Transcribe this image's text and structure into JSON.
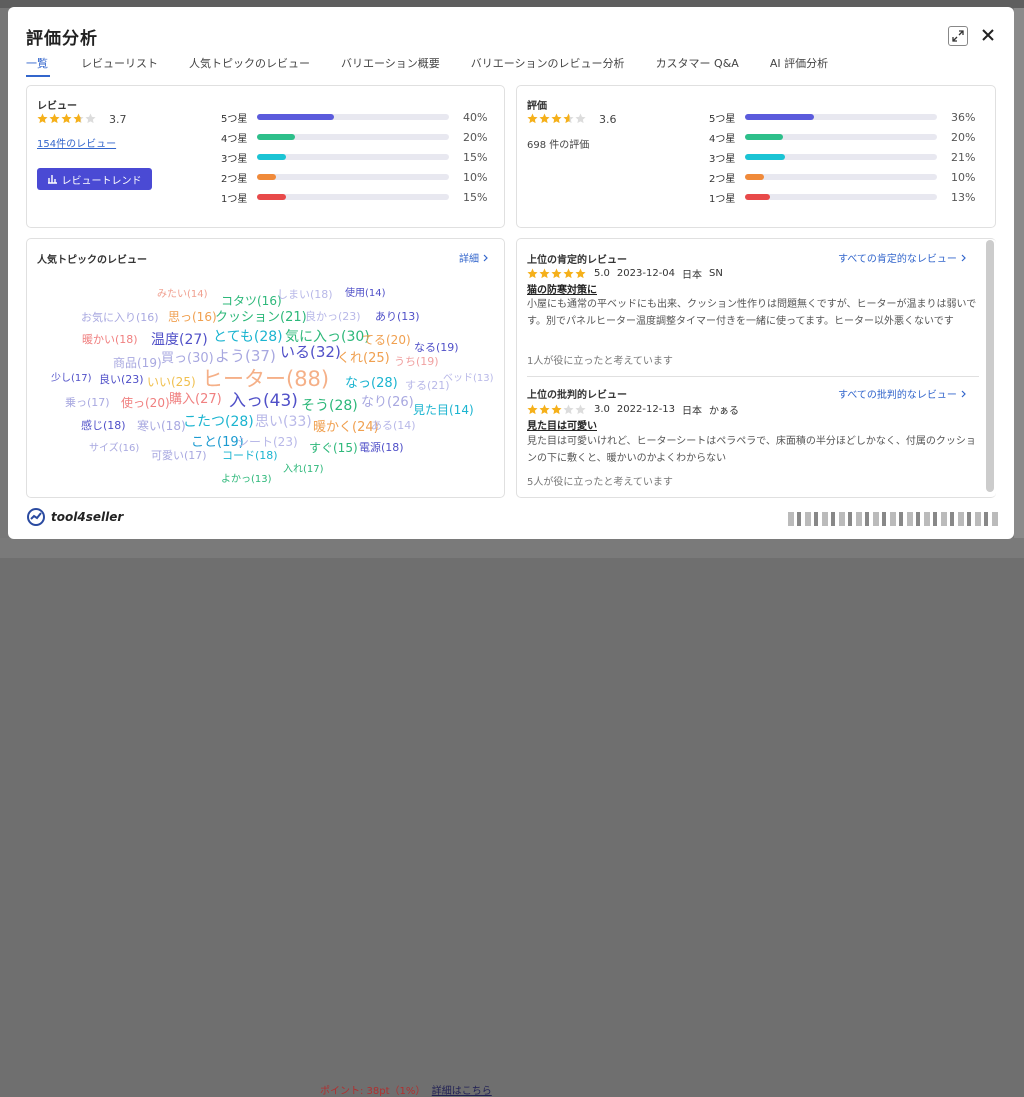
{
  "background": {
    "bottom_text": "ポイント: 38pt（1%）",
    "bottom_link": "詳細はこちら"
  },
  "modal": {
    "title": "評価分析",
    "tabs": [
      {
        "label": "一覧",
        "active": true
      },
      {
        "label": "レビューリスト"
      },
      {
        "label": "人気トピックのレビュー"
      },
      {
        "label": "バリエーション概要"
      },
      {
        "label": "バリエーションのレビュー分析"
      },
      {
        "label": "カスタマー Q&A"
      },
      {
        "label": "AI 評価分析"
      }
    ]
  },
  "reviews_card": {
    "title": "レビュー",
    "rating": "3.7",
    "rating_value": 3.7,
    "count_link": "154件のレビュー",
    "trend_button": "レビュートレンド",
    "distribution": [
      {
        "label": "5つ星",
        "pct": "40%",
        "value": 40,
        "color": "#5b5bdc"
      },
      {
        "label": "4つ星",
        "pct": "20%",
        "value": 20,
        "color": "#2dbf8a"
      },
      {
        "label": "3つ星",
        "pct": "15%",
        "value": 15,
        "color": "#1bc4d4"
      },
      {
        "label": "2つ星",
        "pct": "10%",
        "value": 10,
        "color": "#f08a3a"
      },
      {
        "label": "1つ星",
        "pct": "15%",
        "value": 15,
        "color": "#e84a4a"
      }
    ]
  },
  "ratings_card": {
    "title": "評価",
    "rating": "3.6",
    "rating_value": 3.6,
    "count_text": "698 件の評価",
    "distribution": [
      {
        "label": "5つ星",
        "pct": "36%",
        "value": 36,
        "color": "#5b5bdc"
      },
      {
        "label": "4つ星",
        "pct": "20%",
        "value": 20,
        "color": "#2dbf8a"
      },
      {
        "label": "3つ星",
        "pct": "21%",
        "value": 21,
        "color": "#1bc4d4"
      },
      {
        "label": "2つ星",
        "pct": "10%",
        "value": 10,
        "color": "#f08a3a"
      },
      {
        "label": "1つ星",
        "pct": "13%",
        "value": 13,
        "color": "#e84a4a"
      }
    ]
  },
  "topics_card": {
    "title": "人気トピックのレビュー",
    "detail_link": "詳細",
    "words": [
      {
        "t": "みたい(14)",
        "c": "#f0a090"
      },
      {
        "t": "コタツ(16)",
        "c": "#2db87a"
      },
      {
        "t": "しまい(18)",
        "c": "#b8b8e8"
      },
      {
        "t": "使用(14)",
        "c": "#5050c8"
      },
      {
        "t": "お気に入り(16)",
        "c": "#a8a8e0"
      },
      {
        "t": "思っ(16)",
        "c": "#f0a050"
      },
      {
        "t": "クッション(21)",
        "c": "#2db87a"
      },
      {
        "t": "良かっ(23)",
        "c": "#b8b8e8"
      },
      {
        "t": "あり(13)",
        "c": "#5050c8"
      },
      {
        "t": "暖かい(18)",
        "c": "#f08080"
      },
      {
        "t": "温度(27)",
        "c": "#5050c8"
      },
      {
        "t": "とても(28)",
        "c": "#1bb4d0"
      },
      {
        "t": "気に入っ(30)",
        "c": "#2db87a"
      },
      {
        "t": "てる(20)",
        "c": "#f0a050"
      },
      {
        "t": "なる(19)",
        "c": "#5050c8"
      },
      {
        "t": "商品(19)",
        "c": "#a8a8e0"
      },
      {
        "t": "買っ(30)",
        "c": "#a8a8e0"
      },
      {
        "t": "よう(37)",
        "c": "#a8a8e0"
      },
      {
        "t": "いる(32)",
        "c": "#5050c8"
      },
      {
        "t": "くれ(25)",
        "c": "#f0a050"
      },
      {
        "t": "うち(19)",
        "c": "#f0a0a0"
      },
      {
        "t": "少し(17)",
        "c": "#5050c8"
      },
      {
        "t": "良い(23)",
        "c": "#5050c8"
      },
      {
        "t": "いい(25)",
        "c": "#f0c050"
      },
      {
        "t": "ヒーター(88)",
        "c": "#f5b088"
      },
      {
        "t": "なっ(28)",
        "c": "#1bb4d0"
      },
      {
        "t": "する(21)",
        "c": "#b8b8e8"
      },
      {
        "t": "ベッド(13)",
        "c": "#b8b8e8"
      },
      {
        "t": "乗っ(17)",
        "c": "#a8a8e0"
      },
      {
        "t": "使っ(20)",
        "c": "#f08080"
      },
      {
        "t": "購入(27)",
        "c": "#f08080"
      },
      {
        "t": "入っ(43)",
        "c": "#5050c8"
      },
      {
        "t": "そう(28)",
        "c": "#2db87a"
      },
      {
        "t": "なり(26)",
        "c": "#a8a8e0"
      },
      {
        "t": "見た目(14)",
        "c": "#1bb4d0"
      },
      {
        "t": "感じ(18)",
        "c": "#5050c8"
      },
      {
        "t": "寒い(18)",
        "c": "#a8a8e0"
      },
      {
        "t": "こたつ(28)",
        "c": "#1bb4d0"
      },
      {
        "t": "思い(33)",
        "c": "#b8b8e8"
      },
      {
        "t": "暖かく(24)",
        "c": "#f0a050"
      },
      {
        "t": "ある(14)",
        "c": "#b8b8e8"
      },
      {
        "t": "こと(19)",
        "c": "#1b9ad0"
      },
      {
        "t": "シート(23)",
        "c": "#b8b8e8"
      },
      {
        "t": "すぐ(15)",
        "c": "#2db87a"
      },
      {
        "t": "電源(18)",
        "c": "#5050c8"
      },
      {
        "t": "サイズ(16)",
        "c": "#a8a8e0"
      },
      {
        "t": "可愛い(17)",
        "c": "#a8a8e0"
      },
      {
        "t": "コード(18)",
        "c": "#1bb4d0"
      },
      {
        "t": "入れ(17)",
        "c": "#2db87a"
      },
      {
        "t": "よかっ(13)",
        "c": "#2db87a"
      }
    ]
  },
  "positive_review": {
    "title": "上位の肯定的レビュー",
    "more_link": "すべての肯定的なレビュー",
    "rating": "5.0",
    "rating_value": 5,
    "date": "2023-12-04",
    "country": "日本",
    "author": "SN",
    "headline": "猫の防寒対策に",
    "body": "小屋にも通常の平ベッドにも出来、クッション性作りは問題無くですが、ヒーターが温まりは弱いです。別でパネルヒーター温度調整タイマー付きを一緒に使ってます。ヒーター以外悪くないです",
    "helpful": "1人が役に立ったと考えています"
  },
  "negative_review": {
    "title": "上位の批判的レビュー",
    "more_link": "すべての批判的なレビュー",
    "rating": "3.0",
    "rating_value": 3,
    "date": "2022-12-13",
    "country": "日本",
    "author": "かぁる",
    "headline": "見た目は可愛い",
    "body": "見た目は可愛いけれど、ヒーターシートはペラペラで、床面積の半分ほどしかなく、付属のクッションの下に敷くと、暖かいのかよくわからない",
    "helpful": "5人が役に立ったと考えています"
  },
  "footer": {
    "logo_text": "tool4seller"
  },
  "colors": {
    "accent": "#3366cc",
    "star": "#f5b01a",
    "button": "#4a4ad4"
  }
}
